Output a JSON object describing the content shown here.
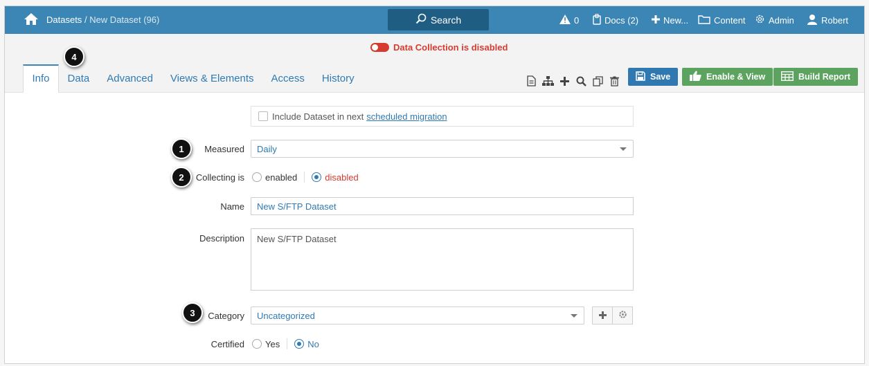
{
  "topbar": {
    "breadcrumb_root": "Datasets",
    "breadcrumb_separator": "/",
    "breadcrumb_current": "New Dataset (96)",
    "search_label": "Search",
    "alerts_count": "0",
    "docs_label": "Docs (2)",
    "new_label": "New...",
    "content_label": "Content",
    "admin_label": "Admin",
    "user_label": "Robert"
  },
  "status": {
    "data_collection": "Data Collection is disabled",
    "color": "#d63b30"
  },
  "tabs": [
    {
      "label": "Info",
      "active": true
    },
    {
      "label": "Data",
      "active": false
    },
    {
      "label": "Advanced",
      "active": false
    },
    {
      "label": "Views & Elements",
      "active": false
    },
    {
      "label": "Access",
      "active": false
    },
    {
      "label": "History",
      "active": false
    }
  ],
  "toolbar": {
    "icons": [
      "document-icon",
      "hierarchy-icon",
      "plus-icon",
      "search-icon",
      "copy-icon",
      "trash-icon"
    ],
    "save_label": "Save",
    "enable_view_label": "Enable & View",
    "build_report_label": "Build Report"
  },
  "callouts": [
    "1",
    "2",
    "3",
    "4"
  ],
  "form": {
    "migration_text": "Include Dataset in next",
    "migration_link": "scheduled migration",
    "measured_label": "Measured",
    "measured_value": "Daily",
    "collecting_label": "Collecting is",
    "collecting_options": [
      "enabled",
      "disabled"
    ],
    "collecting_selected": "disabled",
    "name_label": "Name",
    "name_value": "New S/FTP Dataset",
    "description_label": "Description",
    "description_value": "New S/FTP Dataset",
    "category_label": "Category",
    "category_value": "Uncategorized",
    "certified_label": "Certified",
    "certified_options": [
      "Yes",
      "No"
    ],
    "certified_selected": "No"
  },
  "colors": {
    "topbar": "#3b86b5",
    "link": "#2f7ab3",
    "save_button": "#2f79b0",
    "green_button": "#5ca35f",
    "disabled_red": "#d63b30"
  }
}
